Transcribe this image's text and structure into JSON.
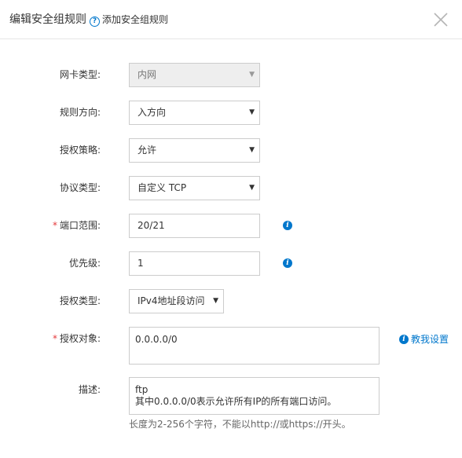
{
  "dialog": {
    "title": "编辑安全组规则",
    "help_icon": "question-circle-icon",
    "help_link": "添加安全组规则",
    "close_icon": "close-icon"
  },
  "form": {
    "nic_type": {
      "label": "网卡类型:",
      "value": "内网",
      "disabled": true
    },
    "direction": {
      "label": "规则方向:",
      "value": "入方向"
    },
    "policy": {
      "label": "授权策略:",
      "value": "允许"
    },
    "protocol": {
      "label": "协议类型:",
      "value": "自定义 TCP"
    },
    "port_range": {
      "required_mark": "*",
      "label": "端口范围:",
      "value": "20/21",
      "info_icon": "info-icon"
    },
    "priority": {
      "label": "优先级:",
      "value": "1",
      "info_icon": "info-icon"
    },
    "auth_type": {
      "label": "授权类型:",
      "value": "IPv4地址段访问"
    },
    "auth_object": {
      "required_mark": "*",
      "label": "授权对象:",
      "value": "0.0.0.0/0",
      "help_link": "教我设置",
      "info_icon": "info-icon"
    },
    "description": {
      "label": "描述:",
      "value": "ftp\n其中0.0.0.0/0表示允许所有IP的所有端口访问。",
      "hint": "长度为2-256个字符，不能以http://或https://开头。"
    }
  },
  "caret_glyph": "▼",
  "colors": {
    "link": "#0077cc",
    "required": "#e4393c",
    "border": "#cccccc",
    "disabled_bg": "#eeeeee"
  }
}
